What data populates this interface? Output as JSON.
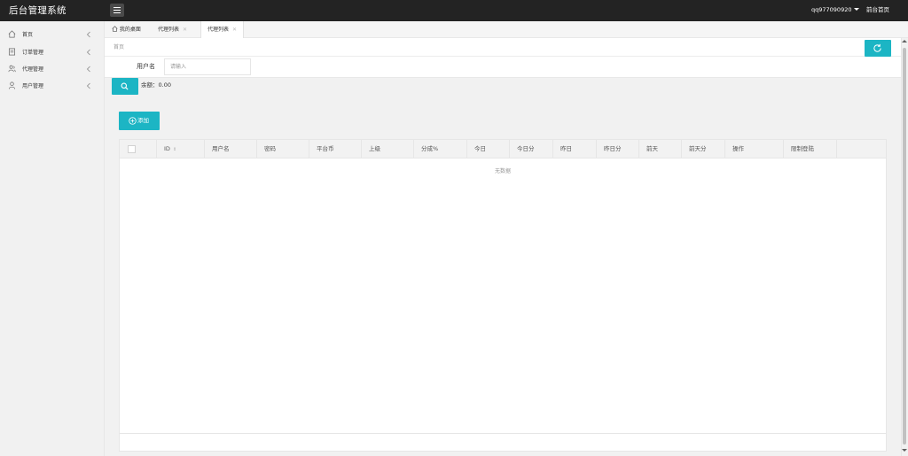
{
  "app": {
    "title": "后台管理系统",
    "user": "qq977090920",
    "home_link": "前台首页"
  },
  "sidebar": {
    "items": [
      {
        "label": "首页",
        "icon": "home-icon"
      },
      {
        "label": "订单管理",
        "icon": "order-icon"
      },
      {
        "label": "代理管理",
        "icon": "agents-icon"
      },
      {
        "label": "用户管理",
        "icon": "user-icon"
      }
    ]
  },
  "tabs": [
    {
      "label": "我的桌面"
    },
    {
      "label": "代理列表"
    },
    {
      "label": "代理列表"
    }
  ],
  "breadcrumb": "首页",
  "search": {
    "label": "用户名",
    "placeholder": "请输入"
  },
  "balance": "余额：0.00",
  "add_label": "添加",
  "table": {
    "columns": [
      "ID",
      "用户名",
      "密码",
      "平台币",
      "上级",
      "分成%",
      "今日",
      "今日分",
      "昨日",
      "昨日分",
      "前天",
      "前天分",
      "操作",
      "限制登陆"
    ],
    "empty_text": "无数据",
    "rows": []
  },
  "colors": {
    "topbar": "#232323",
    "accent": "#1cb5c4",
    "background": "#f1f1f1"
  }
}
